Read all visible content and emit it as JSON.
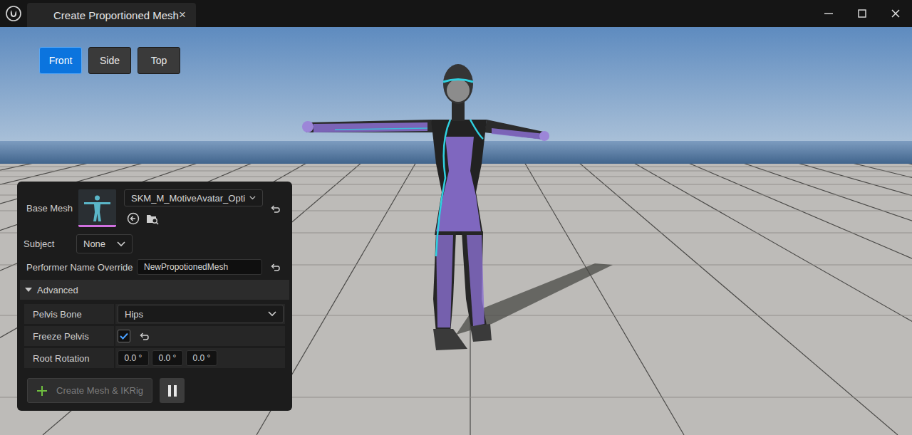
{
  "window": {
    "title": "Create Proportioned Mesh",
    "tab_close": "×"
  },
  "view_buttons": [
    {
      "label": "Front",
      "selected": true
    },
    {
      "label": "Side",
      "selected": false
    },
    {
      "label": "Top",
      "selected": false
    }
  ],
  "panel": {
    "base_mesh": {
      "label": "Base Mesh",
      "value": "SKM_M_MotiveAvatar_Opti"
    },
    "subject": {
      "label": "Subject",
      "value": "None"
    },
    "performer_name_override": {
      "label": "Performer Name Override",
      "value": "NewPropotionedMesh"
    },
    "advanced": {
      "label": "Advanced",
      "expanded": true,
      "pelvis_bone": {
        "label": "Pelvis Bone",
        "value": "Hips"
      },
      "freeze_pelvis": {
        "label": "Freeze Pelvis",
        "checked": true
      },
      "root_rotation": {
        "label": "Root Rotation",
        "values": [
          "0.0 °",
          "0.0 °",
          "0.0 °"
        ]
      }
    },
    "create_button": {
      "label": "Create Mesh & IKRig",
      "disabled": true
    }
  }
}
